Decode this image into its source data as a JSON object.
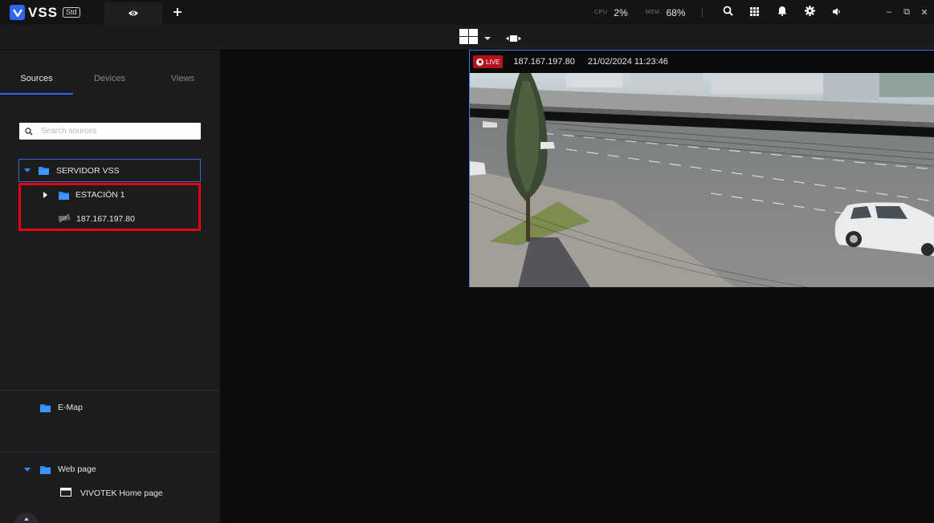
{
  "topbar": {
    "brand": "VSS",
    "edition": "Std",
    "cpu_label": "CPU",
    "cpu_value": "2%",
    "mem_label": "MEM",
    "mem_value": "68%",
    "icons": [
      "eye-icon",
      "plus-icon",
      "search-icon",
      "grid-apps-icon",
      "bell-icon",
      "gear-icon",
      "volume-icon",
      "minimize-icon",
      "restore-icon",
      "close-icon"
    ],
    "window_buttons": {
      "minimize": "–",
      "restore": "⧉",
      "close": "✕"
    }
  },
  "toolbar": {
    "icons": [
      "layout-2x2-icon",
      "chevron-down-icon",
      "fullscreen-icon"
    ]
  },
  "sidebar": {
    "tabs": [
      {
        "label": "Sources",
        "active": true
      },
      {
        "label": "Devices",
        "active": false
      },
      {
        "label": "Views",
        "active": false
      }
    ],
    "search_placeholder": "Search sources",
    "tree": {
      "server": "SERVIDOR VSS",
      "station": "ESTACIÓN 1",
      "camera": "187.167.197.80"
    },
    "emap_label": "E-Map",
    "webpage_label": "Web page",
    "webpage_item": "VIVOTEK Home page"
  },
  "video": {
    "live_label": "LIVE",
    "camera_ip": "187.167.197.80",
    "timestamp": "21/02/2024 11:23:46"
  },
  "colors": {
    "accent": "#2d66f0",
    "folder": "#2d86ff",
    "live": "#b3131a",
    "highlight": "#e3000f"
  }
}
